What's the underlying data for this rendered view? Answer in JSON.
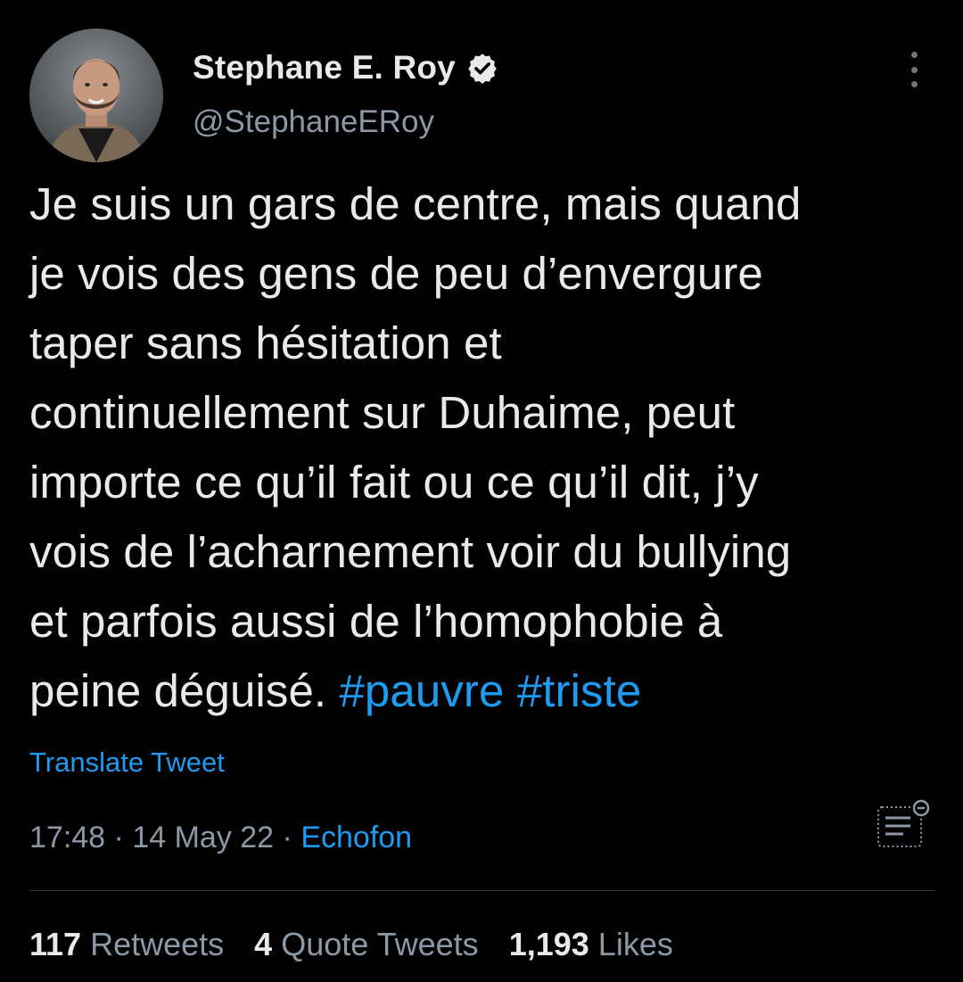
{
  "author": {
    "name": "Stephane E. Roy",
    "handle": "@StephaneERoy",
    "verified": true,
    "avatar_icon": "profile-photo"
  },
  "tweet": {
    "lines": [
      "Je suis un gars de centre, mais quand",
      "je vois des gens de peu d’envergure",
      "taper sans hésitation et",
      "continuellement sur Duhaime, peut",
      "importe ce qu’il fait ou ce qu’il dit, j’y",
      "vois de l’acharnement voir du bullying",
      "et parfois aussi de l’homophobie à"
    ],
    "last_line_text": "peine déguisé.",
    "hashtags": [
      "#pauvre",
      "#triste"
    ]
  },
  "translate_label": "Translate Tweet",
  "meta": {
    "time": "17:48",
    "separator": "·",
    "date": "14 May 22",
    "source": "Echofon"
  },
  "stats": {
    "retweets_count": "117",
    "retweets_label": "Retweets",
    "quote_count": "4",
    "quote_label": "Quote Tweets",
    "likes_count": "1,193",
    "likes_label": "Likes"
  },
  "colors": {
    "background": "#000000",
    "text": "#e7e9ea",
    "secondary": "#8b98a5",
    "accent": "#1d9bf0"
  }
}
